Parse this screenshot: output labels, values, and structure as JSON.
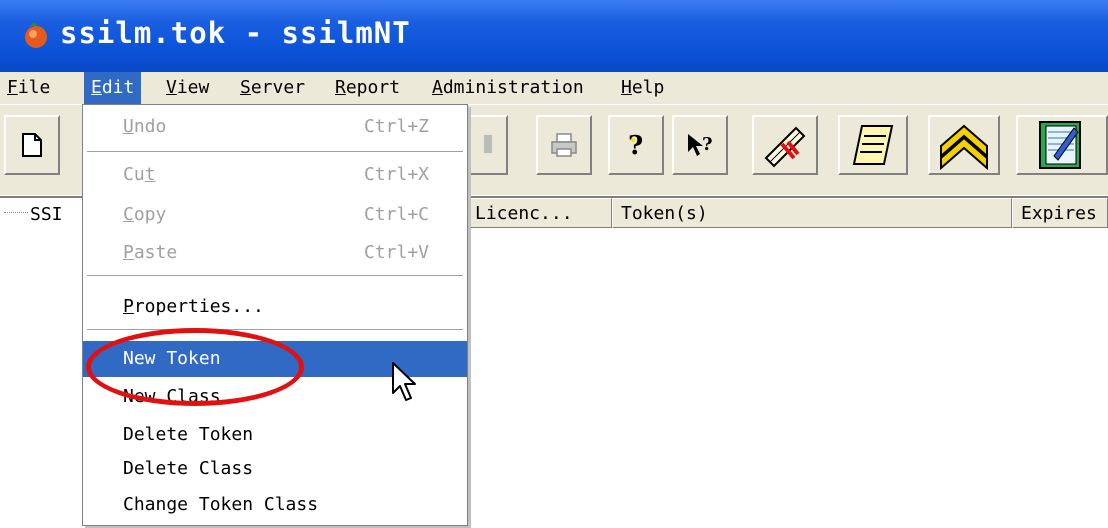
{
  "window": {
    "title": "ssilm.tok - ssilmNT"
  },
  "menubar": [
    {
      "label": "File",
      "ul": "F",
      "rest": "ile"
    },
    {
      "label": "Edit",
      "ul": "E",
      "rest": "dit"
    },
    {
      "label": "View",
      "ul": "V",
      "rest": "iew"
    },
    {
      "label": "Server",
      "ul": "S",
      "rest": "erver"
    },
    {
      "label": "Report",
      "ul": "R",
      "rest": "eport"
    },
    {
      "label": "Administration",
      "ul": "A",
      "rest": "dministration"
    },
    {
      "label": "Help",
      "ul": "H",
      "rest": "elp"
    }
  ],
  "toolbar": {
    "icons": [
      "new-document-icon",
      "properties-icon",
      "print-icon",
      "help-icon",
      "context-help-icon",
      "token-scroll-icon",
      "license-scroll-icon",
      "chevron-rank-icon",
      "notebook-edit-icon"
    ]
  },
  "tree": {
    "root_label": "SSI"
  },
  "columns": [
    {
      "label": "Licenc..."
    },
    {
      "label": "Token(s)"
    },
    {
      "label": "Expires"
    }
  ],
  "edit_menu": {
    "undo": {
      "ul": "U",
      "rest": "ndo",
      "shortcut": "Ctrl+Z"
    },
    "cut": {
      "pre": "Cu",
      "ul": "t",
      "shortcut": "Ctrl+X"
    },
    "copy": {
      "ul": "C",
      "rest": "opy",
      "shortcut": "Ctrl+C"
    },
    "paste": {
      "ul": "P",
      "rest": "aste",
      "shortcut": "Ctrl+V"
    },
    "properties": {
      "ul": "P",
      "rest": "roperties..."
    },
    "new_token": "New Token",
    "new_class": "New Class",
    "delete_token": "Delete Token",
    "delete_class": "Delete Class",
    "change_token_class": "Change Token Class"
  },
  "colors": {
    "titlebar": "#0a49c7",
    "highlight": "#316ac5",
    "annotation": "#e21010"
  }
}
